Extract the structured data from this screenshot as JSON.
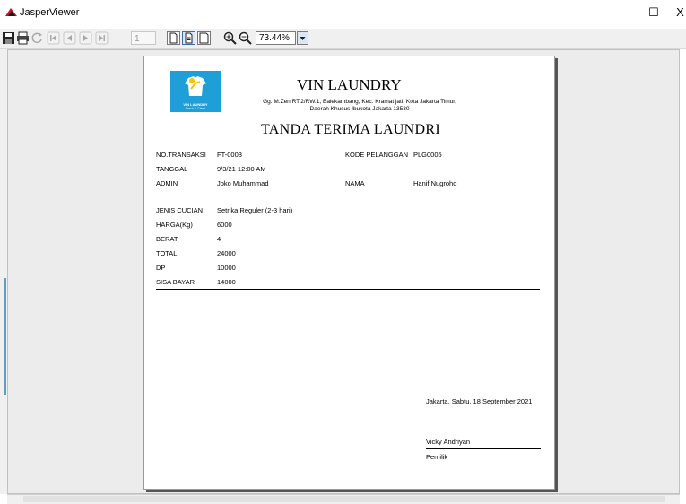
{
  "window": {
    "title": "JasperViewer",
    "minimize": "–",
    "maximize": "☐",
    "close": "X"
  },
  "toolbar": {
    "page_number": "1",
    "zoom": "73.44%"
  },
  "report": {
    "company": "VIN LAUNDRY",
    "logo_text": "VIN LAUNDRY",
    "logo_tagline": "Fresh & Clean",
    "address_line1": "Gg. M.Zen RT.2/RW.1, Balekambang, Kec. Kramat jati, Kota Jakarta Timur,",
    "address_line2": "Daerah Khusus Ibukota Jakarta 13530",
    "doc_title": "TANDA TERIMA LAUNDRI",
    "fields": {
      "no_transaksi_label": "NO.TRANSAKSI",
      "no_transaksi": "FT-0003",
      "tanggal_label": "TANGGAL",
      "tanggal": "9/3/21 12:00 AM",
      "admin_label": "ADMIN",
      "admin": "Joko Muhammad",
      "kode_pelanggan_label": "KODE PELANGGAN",
      "kode_pelanggan": "PLG0005",
      "nama_label": "NAMA",
      "nama": "Hanif Nugroho",
      "jenis_cucian_label": "JENIS CUCIAN",
      "jenis_cucian": "Setrika Reguler (2-3 hari)",
      "harga_label": "HARGA(Kg)",
      "harga": "6000",
      "berat_label": "BERAT",
      "berat": "4",
      "total_label": "TOTAL",
      "total": "24000",
      "dp_label": "DP",
      "dp": "10000",
      "sisa_bayar_label": "SISA BAYAR",
      "sisa_bayar": "14000"
    },
    "signature": {
      "place_date": "Jakarta, Sabtu, 18 September 2021",
      "name": "Vicky Andriyan",
      "role": "Pemilik"
    }
  }
}
